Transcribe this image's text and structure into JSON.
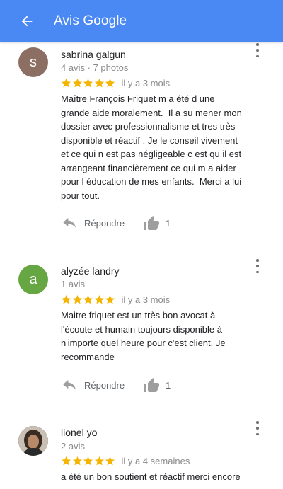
{
  "appbar": {
    "title": "Avis Google",
    "back_icon": "arrow-back-icon",
    "background": "#4a89f3"
  },
  "reviews": [
    {
      "author": "sabrina galgun",
      "initial": "s",
      "avatar_color": "#8d6e63",
      "meta": "4 avis · 7 photos",
      "rating": 5,
      "date": "il y a 3 mois",
      "text": "Maître François Friquet m a été d une\ngrande aide moralement.  Il a su mener mon\ndossier avec professionnalisme et tres très\ndisponible et réactif . Je le conseil vivement\net ce qui n est pas négligeable c est qu il est\narrangeant financièrement ce qui m a aider\npour l éducation de mes enfants.  Merci a lui\npour tout.",
      "reply_label": "Répondre",
      "likes": "1"
    },
    {
      "author": "alyzée landry",
      "initial": "a",
      "avatar_color": "#66a743",
      "meta": "1 avis",
      "rating": 5,
      "date": "il y a 3 mois",
      "text": "Maitre friquet est un très bon avocat à\nl'écoute et humain toujours disponible à\nn'importe quel heure pour c'est client. Je\nrecommande",
      "reply_label": "Répondre",
      "likes": "1"
    },
    {
      "author": "lionel yo",
      "initial": "",
      "avatar_color": "#6b5a4a",
      "meta": "2 avis",
      "rating": 5,
      "date": "il y a 4 semaines",
      "text": "a été un bon soutient et réactif merci encore"
    }
  ],
  "colors": {
    "star": "#f4b400",
    "secondary_text": "#8a8a8a",
    "divider": "#e6e6e6"
  }
}
